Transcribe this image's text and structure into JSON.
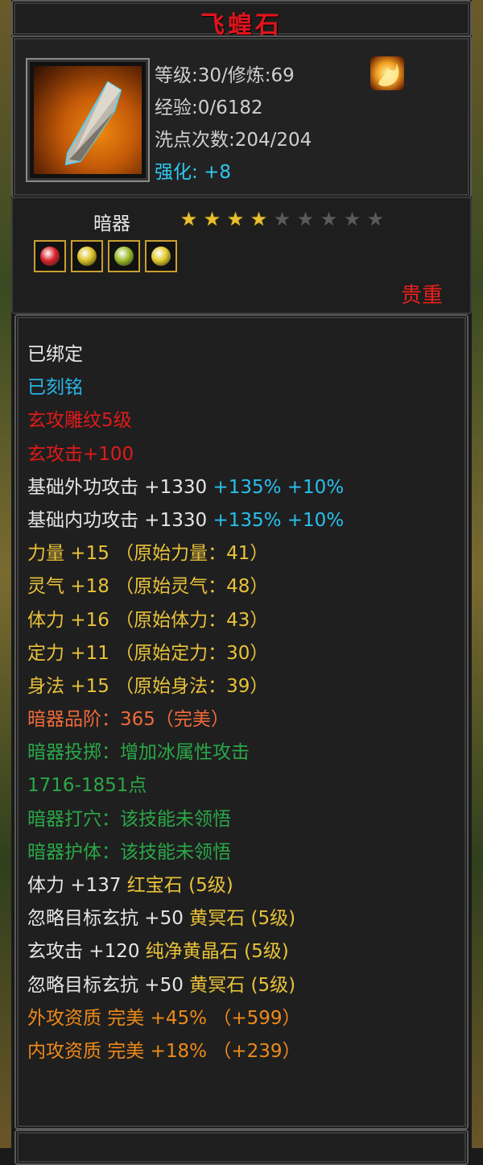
{
  "title": "飞蝗石",
  "item": {
    "icon": "throwing-stone-icon",
    "level_text": "等级:30/修炼:69",
    "exp_text": "经验:0/6182",
    "wash_text": "洗点次数:204/204",
    "strengthen_label": "强化:",
    "strengthen_value": "+8"
  },
  "type_label": "暗器",
  "stars": {
    "filled": 4,
    "total": 9
  },
  "gems": [
    {
      "icon": "red-gem-icon",
      "color": "#d8202a"
    },
    {
      "icon": "yellow-gem-icon",
      "color": "#d8c020"
    },
    {
      "icon": "green-yellow-gem-icon",
      "color": "#9ab828"
    },
    {
      "icon": "yellow-gem-icon",
      "color": "#e0c828"
    }
  ],
  "grade": "贵重",
  "attributes": [
    {
      "color": "#e6e6e6",
      "parts": [
        "已绑定"
      ]
    },
    {
      "color": "#28b4e8",
      "parts": [
        "已刻铭"
      ]
    },
    {
      "color": "#e01a1a",
      "parts": [
        "玄攻雕纹5级"
      ]
    },
    {
      "color": "#e01a1a",
      "parts": [
        "玄攻击+100"
      ]
    },
    {
      "color": "#e6e6e6",
      "parts": [
        "基础外功攻击 +1330 ",
        "+135% +10%"
      ],
      "part_colors": [
        "#e6e6e6",
        "#28c0f0"
      ]
    },
    {
      "color": "#e6e6e6",
      "parts": [
        "基础内功攻击 +1330 ",
        "+135% +10%"
      ],
      "part_colors": [
        "#e6e6e6",
        "#28c0f0"
      ]
    },
    {
      "color": "#e8c23a",
      "parts": [
        "力量 +15 （原始力量：41）"
      ]
    },
    {
      "color": "#e8c23a",
      "parts": [
        "灵气 +18 （原始灵气：48）"
      ]
    },
    {
      "color": "#e8c23a",
      "parts": [
        "体力 +16 （原始体力：43）"
      ]
    },
    {
      "color": "#e8c23a",
      "parts": [
        "定力 +11 （原始定力：30）"
      ]
    },
    {
      "color": "#e8c23a",
      "parts": [
        "身法 +15 （原始身法：39）"
      ]
    },
    {
      "color": "#f06a3a",
      "parts": [
        "暗器品阶：365（完美）"
      ]
    },
    {
      "color": "#2aa848",
      "parts": [
        "暗器投掷：增加冰属性攻击"
      ]
    },
    {
      "color": "#2aa848",
      "parts": [
        "1716-1851点"
      ]
    },
    {
      "color": "#2aa848",
      "parts": [
        "暗器打穴：该技能未领悟"
      ]
    },
    {
      "color": "#2aa848",
      "parts": [
        "暗器护体：该技能未领悟"
      ]
    },
    {
      "color": "#e6e6e6",
      "parts": [
        "体力 +137 ",
        "红宝石 (5级)"
      ],
      "part_colors": [
        "#e6e6e6",
        "#e8c23a"
      ]
    },
    {
      "color": "#e6e6e6",
      "parts": [
        "忽略目标玄抗 +50 ",
        "黄冥石 (5级)"
      ],
      "part_colors": [
        "#e6e6e6",
        "#e8c23a"
      ]
    },
    {
      "color": "#e6e6e6",
      "parts": [
        "玄攻击 +120 ",
        "纯净黄晶石 (5级)"
      ],
      "part_colors": [
        "#e6e6e6",
        "#e8c23a"
      ]
    },
    {
      "color": "#e6e6e6",
      "parts": [
        "忽略目标玄抗 +50 ",
        "黄冥石 (5级)"
      ],
      "part_colors": [
        "#e6e6e6",
        "#e8c23a"
      ]
    },
    {
      "color": "#ee8a1a",
      "parts": [
        "外攻资质  完美 +45% （+599）"
      ]
    },
    {
      "color": "#ee8a1a",
      "parts": [
        "内攻资质  完美 +18% （+239）"
      ]
    }
  ]
}
